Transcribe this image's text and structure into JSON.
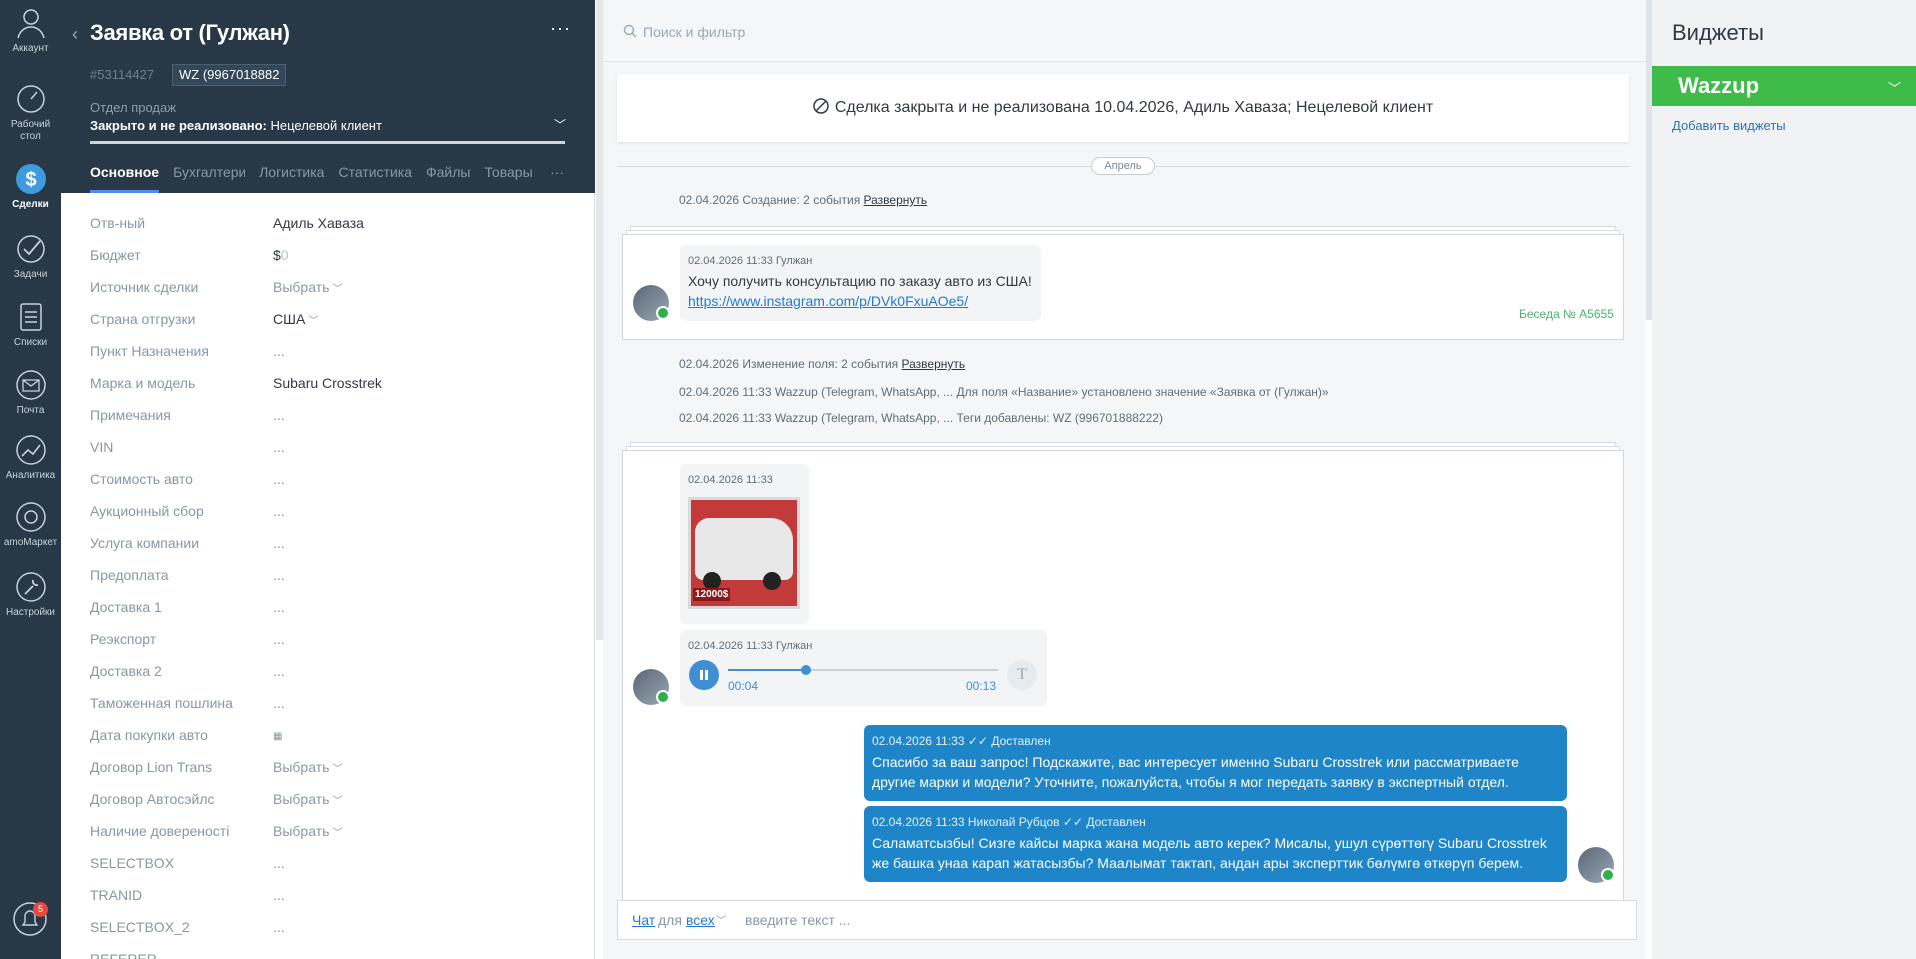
{
  "nav": {
    "account": "Аккаунт",
    "desktop": "Рабочий стол",
    "deals": "Сделки",
    "tasks": "Задачи",
    "lists": "Списки",
    "mail": "Почта",
    "analytics": "Аналитика",
    "market": "amoМаркет",
    "settings": "Настройки",
    "notif_count": "5"
  },
  "card": {
    "title": "Заявка от (Гулжан)",
    "more": "···",
    "deal_id": "#53114427",
    "tag": "WZ (9967018882",
    "pipeline_label": "Отдел продаж",
    "pipeline_status": "Закрыто и не реализовано:",
    "pipeline_reason": " Нецелевой клиент",
    "tabs": [
      "Основное",
      "Бухгалтерия",
      "Логистика",
      "Статистика",
      "Файлы",
      "Товары"
    ],
    "tabs_more": "···",
    "fields": [
      {
        "label": "Отв-ный",
        "value": "Адиль Хаваза"
      },
      {
        "label": "Бюджет",
        "value": "$"
      },
      {
        "label": "Источник сделки",
        "value": "Выбрать"
      },
      {
        "label": "Страна отгрузки",
        "value": "США"
      },
      {
        "label": "Пункт Назначения",
        "value": "..."
      },
      {
        "label": "Марка и модель",
        "value": "Subaru Crosstrek"
      },
      {
        "label": "Примечания",
        "value": "..."
      },
      {
        "label": "VIN",
        "value": "..."
      },
      {
        "label": "Стоимость авто",
        "value": "..."
      },
      {
        "label": "Аукционный сбор",
        "value": "..."
      },
      {
        "label": "Услуга компании",
        "value": "..."
      },
      {
        "label": "Предоплата",
        "value": "..."
      },
      {
        "label": "Доставка 1",
        "value": "..."
      },
      {
        "label": "Реэкспорт",
        "value": "..."
      },
      {
        "label": "Доставка 2",
        "value": "..."
      },
      {
        "label": "Таможенная пошлина",
        "value": "..."
      },
      {
        "label": "Дата покупки авто",
        "value": ""
      },
      {
        "label": "Договор Lion Trans",
        "value": "Выбрать"
      },
      {
        "label": "Договор Автосэйлс",
        "value": "Выбрать"
      },
      {
        "label": "Наличие довереності",
        "value": "Выбрать"
      },
      {
        "label": "SELECTBOX",
        "value": "..."
      },
      {
        "label": "TRANID",
        "value": "..."
      },
      {
        "label": "SELECTBOX_2",
        "value": "..."
      },
      {
        "label": "REFERER",
        "value": ""
      }
    ],
    "budget_zero": "0"
  },
  "feed": {
    "search_placeholder": "Поиск и фильтр",
    "closed_text": "Сделка закрыта и не реализована 10.04.2026, Адиль Хаваза; Нецелевой клиент",
    "month": "Апрель",
    "note1_prefix": "02.04.2026 Создание: 2 события ",
    "note1_link": "Развернуть",
    "msg1_meta": "02.04.2026 11:33 Гулжан",
    "msg1_text": "Хочу получить консультацию по заказу авто из США!",
    "msg1_link": "https://www.instagram.com/p/DVk0FxuAOe5/",
    "conversation": "Беседа № A5655",
    "note2_prefix": "02.04.2026 Изменение поля: 2 события ",
    "note2_link": "Развернуть",
    "note3": "02.04.2026 11:33 Wazzup (Telegram, WhatsApp, ... Для поля «Название» установлено значение «Заявка от (Гулжан)»",
    "note4": "02.04.2026 11:33 Wazzup (Telegram, WhatsApp, ... Теги добавлены: WZ (996701888222)",
    "img_meta": "02.04.2026 11:33",
    "img_price": "12000$",
    "audio_meta": "02.04.2026 11:33 Гулжан",
    "audio_pos": "00:04",
    "audio_len": "00:13",
    "audio_progress": 0.29,
    "t_label": "T",
    "out1_meta": "02.04.2026 11:33",
    "out1_status": "Доставлен",
    "out1_text": "Спасибо за ваш запрос! Подскажите, вас интересует именно Subaru Crosstrek или рассматриваете другие марки и модели? Уточните, пожалуйста, чтобы я мог передать заявку в экспертный отдел.",
    "out2_meta": "02.04.2026 11:33 Николай Рубцов",
    "out2_status": "Доставлен",
    "out2_text": "Саламатсызбы! Сизге кайсы марка жана модель авто керек? Мисалы, ушул сүрөттөгү Subaru Crosstrek же башка унаа карап жатасызбы? Маалымат тактап, андан ары эксперттик бөлүмгө өткөрүп берем.",
    "chat_word": "Чат",
    "chat_for": "для",
    "chat_all": "всех",
    "chat_placeholder": "введите текст ..."
  },
  "widgets": {
    "title": "Виджеты",
    "wazzup": "Wazzup",
    "add": "Добавить виджеты"
  },
  "colors": {
    "nav_bg": "#283847",
    "accent": "#1e85c9",
    "wazzup": "#3fbb4a",
    "whatsapp": "#2bb24c"
  }
}
